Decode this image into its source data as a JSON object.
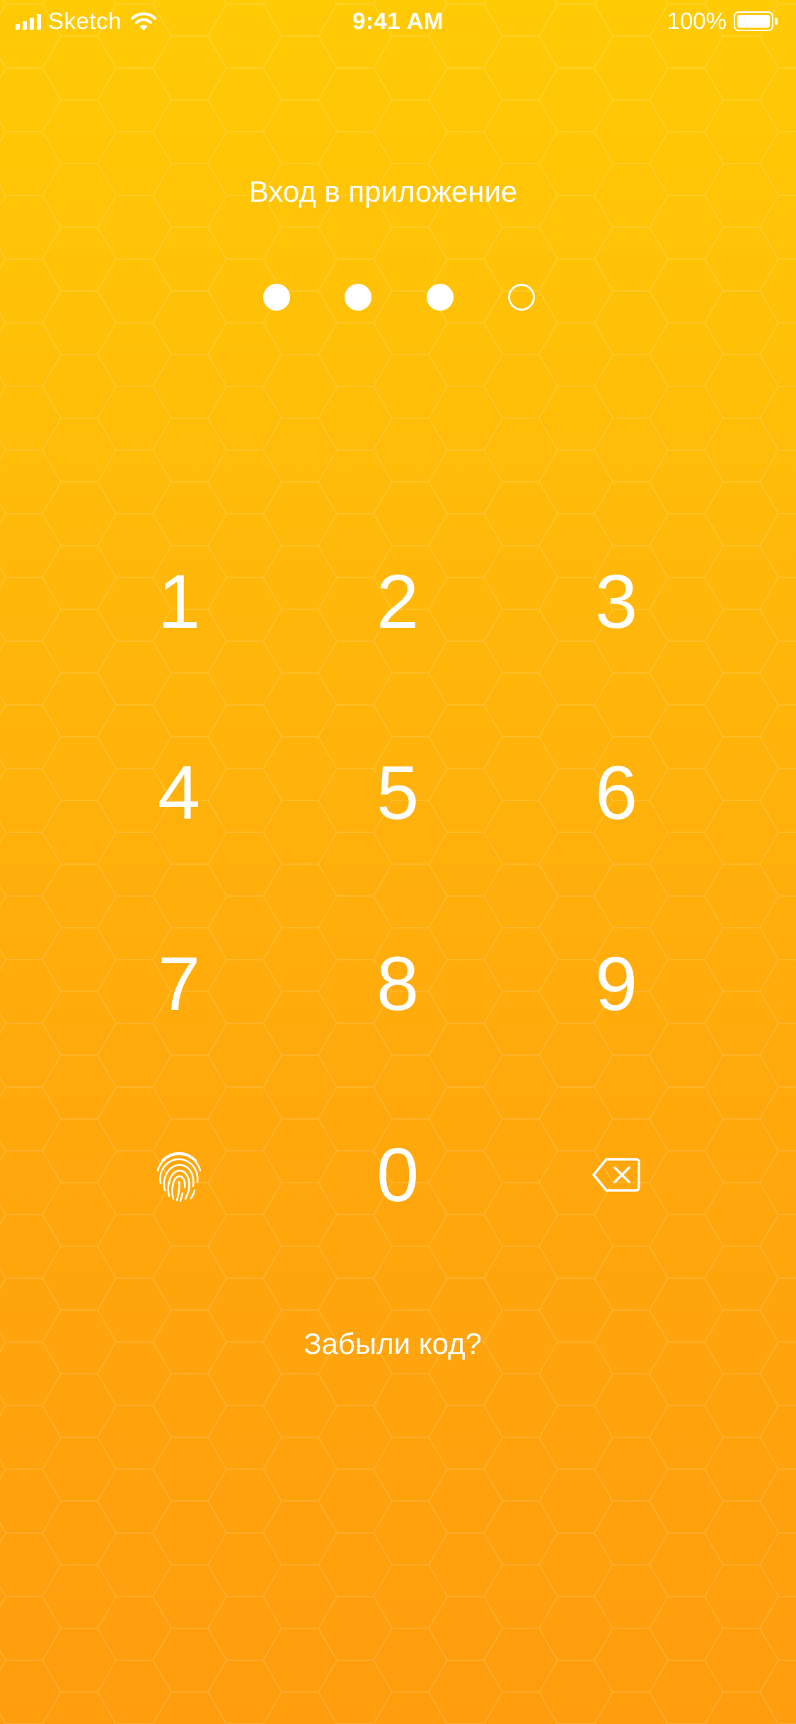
{
  "status_bar": {
    "carrier": "Sketch",
    "time": "9:41 AM",
    "battery": "100%",
    "battery_level": 1.0
  },
  "title": "Вход в приложение",
  "pin": {
    "length": 4,
    "entered": 3
  },
  "keypad": {
    "keys": [
      "1",
      "2",
      "3",
      "4",
      "5",
      "6",
      "7",
      "8",
      "9",
      "0"
    ],
    "biometric_icon": "fingerprint-icon",
    "delete_icon": "backspace-icon"
  },
  "forgot_link": "Забыли код?",
  "colors": {
    "gradient_top": "#ffcb05",
    "gradient_bottom": "#ff9d0d",
    "foreground": "#ffffff",
    "pattern_stroke": "#ffffff"
  }
}
